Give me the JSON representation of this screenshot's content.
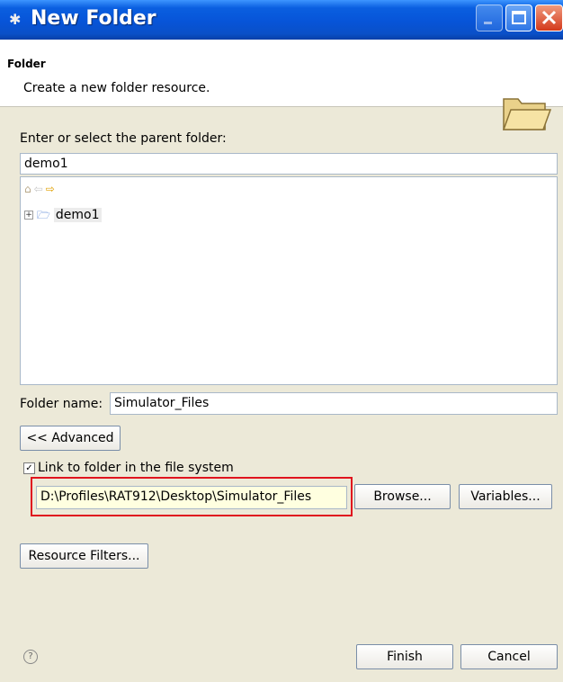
{
  "window": {
    "title": "New Folder",
    "title_icon": "wizard-icon"
  },
  "banner": {
    "heading": "Folder",
    "description": "Create a new folder resource.",
    "icon": "open-folder-icon"
  },
  "parent": {
    "label": "Enter or select the parent folder:",
    "value": "demo1"
  },
  "tree": {
    "nav_icons": [
      "home-icon",
      "back-arrow-icon",
      "forward-arrow-icon"
    ],
    "items": [
      {
        "label": "demo1",
        "expanded": false
      }
    ]
  },
  "folder_name": {
    "label": "Folder name:",
    "value": "Simulator_Files"
  },
  "advanced_button": "<< Advanced",
  "link": {
    "checkbox_label": "Link to folder in the file system",
    "checked": true,
    "path": "D:\\Profiles\\RAT912\\Desktop\\Simulator_Files",
    "browse_label": "Browse...",
    "variables_label": "Variables..."
  },
  "resource_filters_button": "Resource Filters...",
  "footer": {
    "finish_label": "Finish",
    "cancel_label": "Cancel"
  },
  "colors": {
    "titlebar": "#0754d8",
    "highlight_border": "#e0141e",
    "path_field_bg": "#ffffe0"
  }
}
